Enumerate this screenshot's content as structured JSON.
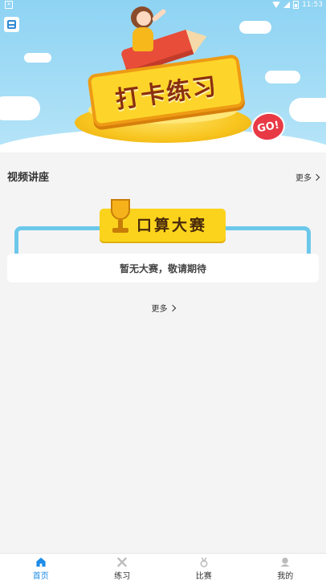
{
  "status_bar": {
    "time": "11:53"
  },
  "hero": {
    "title": "打卡练习",
    "badge": "GO!"
  },
  "video_section": {
    "title": "视频讲座",
    "more_label": "更多"
  },
  "contest_section": {
    "title": "口算大赛",
    "empty_text": "暂无大赛，敬请期待",
    "more_label": "更多"
  },
  "bottom_nav": {
    "items": [
      {
        "label": "首页",
        "icon": "home-icon",
        "active": true
      },
      {
        "label": "练习",
        "icon": "practice-icon",
        "active": false
      },
      {
        "label": "比赛",
        "icon": "medal-icon",
        "active": false
      },
      {
        "label": "我的",
        "icon": "user-icon",
        "active": false
      }
    ]
  },
  "colors": {
    "accent": "#1e8ce8",
    "banner_yellow": "#fbd31c",
    "frame_blue": "#6bc8ea",
    "background": "#f4f4f5"
  }
}
